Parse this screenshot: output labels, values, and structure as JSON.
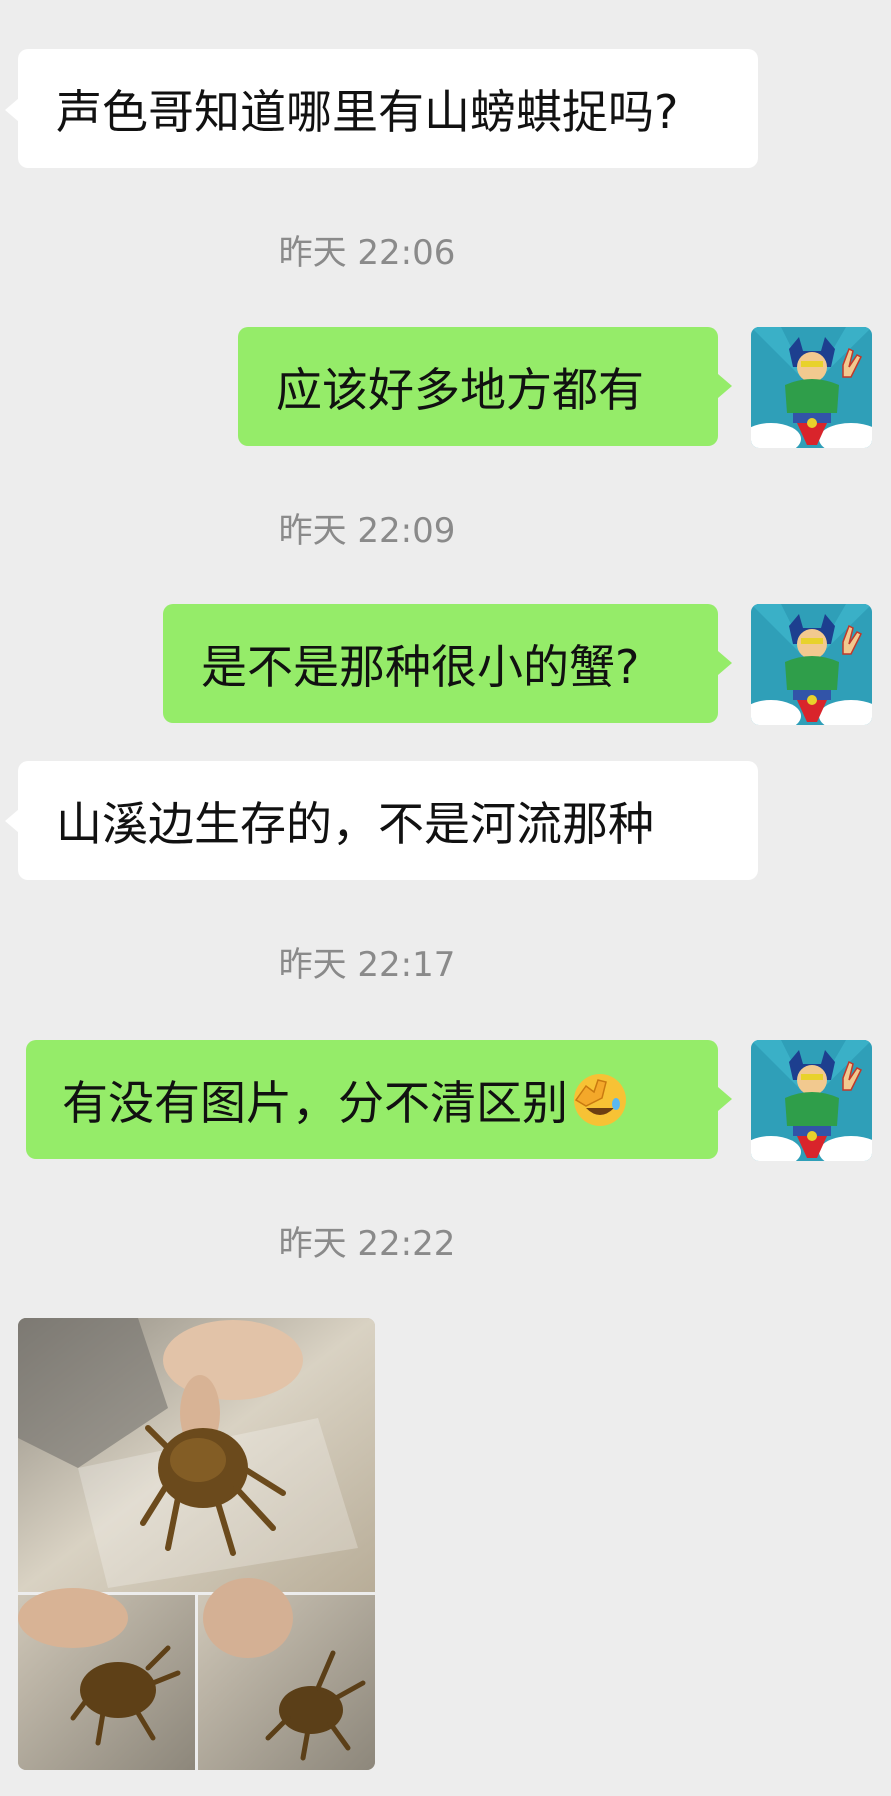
{
  "messages": [
    {
      "direction": "in",
      "text": "声色哥知道哪里有山螃蜞捉吗?"
    },
    {
      "timestamp": "昨天 22:06"
    },
    {
      "direction": "out",
      "text": "应该好多地方都有"
    },
    {
      "timestamp": "昨天 22:09"
    },
    {
      "direction": "out",
      "text": "是不是那种很小的蟹?"
    },
    {
      "direction": "in",
      "text": "山溪边生存的，不是河流那种"
    },
    {
      "timestamp": "昨天 22:17"
    },
    {
      "direction": "out",
      "text": "有没有图片，分不清区别",
      "emoji": "facepalm-laughing-emoji"
    },
    {
      "timestamp": "昨天 22:22"
    },
    {
      "direction": "in",
      "type": "image",
      "content": "photo-collage-of-crab-in-plastic-box"
    }
  ],
  "colors": {
    "background": "#ededed",
    "incoming_bubble": "#ffffff",
    "outgoing_bubble": "#95ec69",
    "timestamp_text": "#8a8a8a"
  }
}
